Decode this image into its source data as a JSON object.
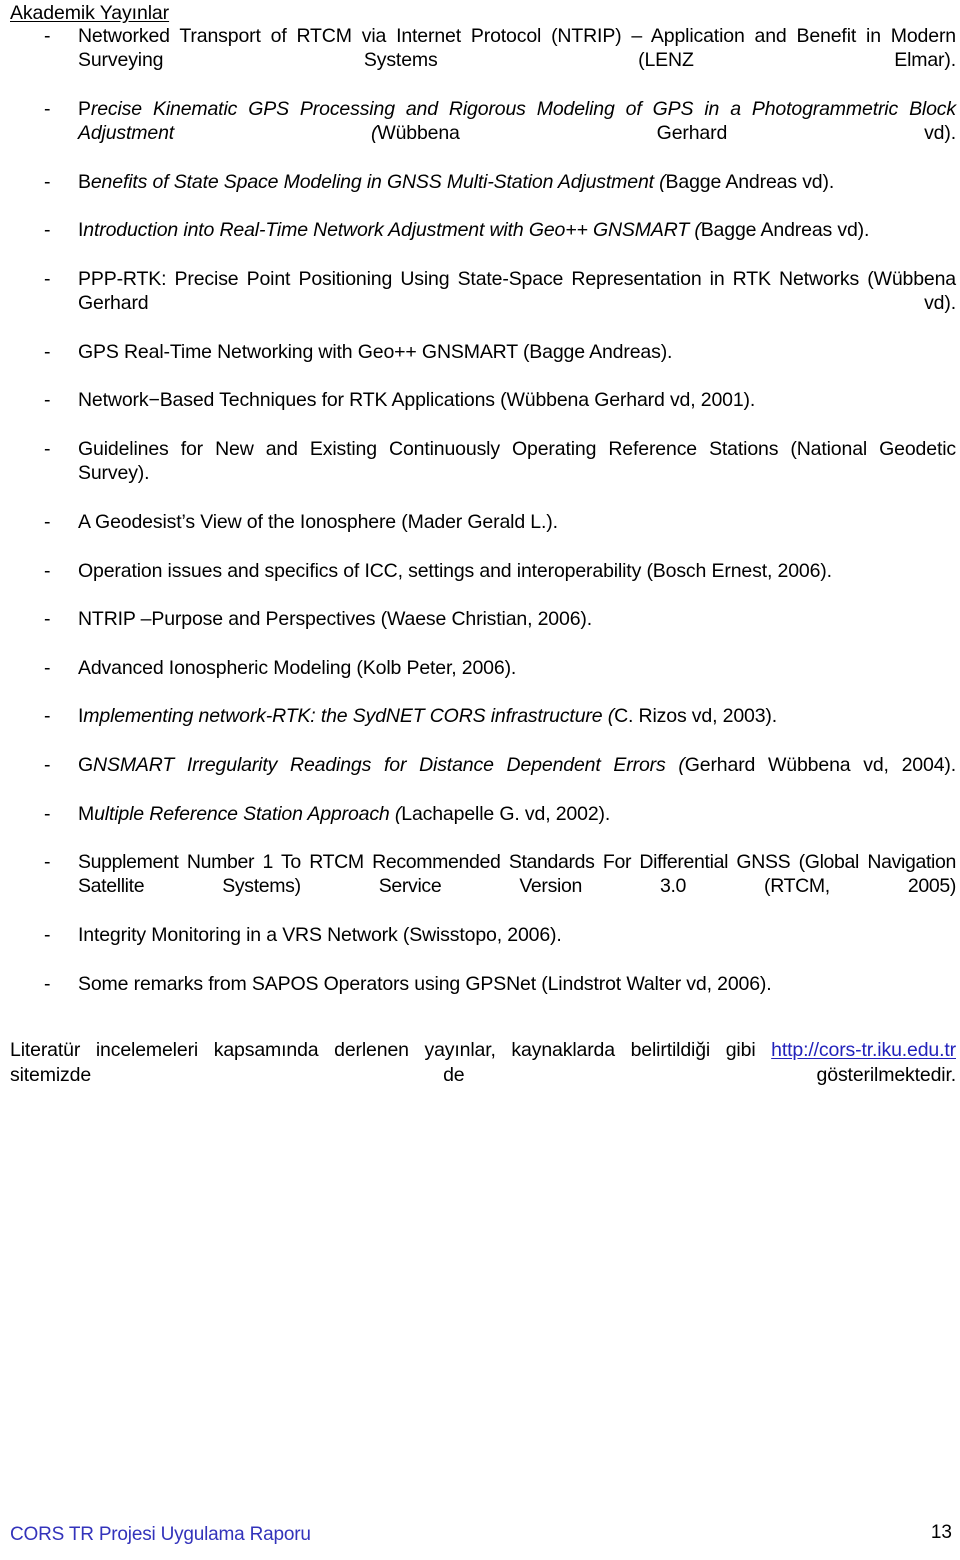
{
  "document": {
    "heading": "Akademik Yayınlar",
    "items": [
      {
        "bullet": "-",
        "style": "roman",
        "justify": true,
        "text": "Networked Transport of RTCM via Internet Protocol (NTRIP) – Application and Benefit in Modern Surveying Systems (LENZ Elmar)."
      },
      {
        "bullet": "-",
        "style": "italic-first-upright",
        "justify": true,
        "first": "P",
        "italic": "recise Kinematic GPS Processing and Rigorous Modeling of GPS  in a Photogrammetric Block Adjustment (",
        "tail": "Wübbena Gerhard vd)."
      },
      {
        "bullet": "-",
        "style": "italic-first-upright",
        "justify": false,
        "first": "B",
        "italic": "enefits of State Space Modeling in GNSS Multi-Station Adjustment (",
        "tail": "Bagge Andreas vd)."
      },
      {
        "bullet": "-",
        "style": "italic-first-upright",
        "justify": false,
        "first": "I",
        "italic": "ntroduction into Real-Time Network Adjustment with Geo++ GNSMART (",
        "tail": "Bagge Andreas vd)."
      },
      {
        "bullet": "-",
        "style": "roman",
        "justify": true,
        "text": "PPP-RTK: Precise Point Positioning Using State-Space Representation in RTK Networks (Wübbena Gerhard vd)."
      },
      {
        "bullet": "-",
        "style": "roman",
        "justify": false,
        "text": "GPS Real-Time Networking with Geo++ GNSMART (Bagge Andreas)."
      },
      {
        "bullet": "-",
        "style": "roman",
        "justify": false,
        "text": "Network−Based Techniques for RTK Applications (Wübbena Gerhard vd, 2001)."
      },
      {
        "bullet": "-",
        "style": "roman",
        "justify": true,
        "text": "Guidelines for New and Existing Continuously Operating Reference Stations (National Geodetic Survey)."
      },
      {
        "bullet": "-",
        "style": "roman",
        "justify": false,
        "text": "A Geodesist’s View of the Ionosphere (Mader Gerald L.)."
      },
      {
        "bullet": "-",
        "style": "roman",
        "justify": false,
        "text": "Operation issues and specifics of ICC, settings and interoperability (Bosch Ernest, 2006)."
      },
      {
        "bullet": "-",
        "style": "roman",
        "justify": false,
        "text": "NTRIP –Purpose and Perspectives (Waese Christian, 2006)."
      },
      {
        "bullet": "-",
        "style": "roman",
        "justify": false,
        "text": "Advanced Ionospheric Modeling (Kolb Peter, 2006)."
      },
      {
        "bullet": "-",
        "style": "italic-first-upright",
        "justify": false,
        "first": "I",
        "italic": "mplementing network-RTK: the SydNET CORS infrastructure (",
        "tail": "C. Rizos vd, 2003)."
      },
      {
        "bullet": "-",
        "style": "italic-first-upright",
        "justify": true,
        "first": "G",
        "italic": "NSMART Irregularity Readings for Distance Dependent Errors (",
        "tail": "Gerhard Wübbena vd, 2004)."
      },
      {
        "bullet": "-",
        "style": "italic-first-upright",
        "justify": false,
        "first": "M",
        "italic": "ultiple Reference Station Approach (",
        "tail": "Lachapelle G. vd, 2002)."
      },
      {
        "bullet": "-",
        "style": "narrow",
        "justify": true,
        "text": "Supplement Number 1 To RTCM Recommended Standards For Differential GNSS (Global Navigation Satellite Systems) Service Version 3.0 (RTCM, 2005)"
      },
      {
        "bullet": "-",
        "style": "roman",
        "justify": false,
        "text": "Integrity Monitoring in a VRS Network (Swisstopo, 2006)."
      },
      {
        "bullet": "-",
        "style": "roman",
        "justify": false,
        "text": "Some remarks from SAPOS Operators using GPSNet (Lindstrot Walter vd, 2006)."
      }
    ],
    "closing": {
      "before_link": "Literatür incelemeleri kapsamında derlenen yayınlar, kaynaklarda belirtildiği gibi ",
      "link_text": "http://cors-tr.iku.edu.tr",
      "after_link": " sitemizde de gösterilmektedir."
    }
  },
  "footer": {
    "title": "CORS TR Projesi Uygulama Raporu",
    "page_number": "13"
  },
  "colors": {
    "link": "#2222bb",
    "footer_title": "#3333bb",
    "text": "#000000",
    "background": "#ffffff"
  }
}
